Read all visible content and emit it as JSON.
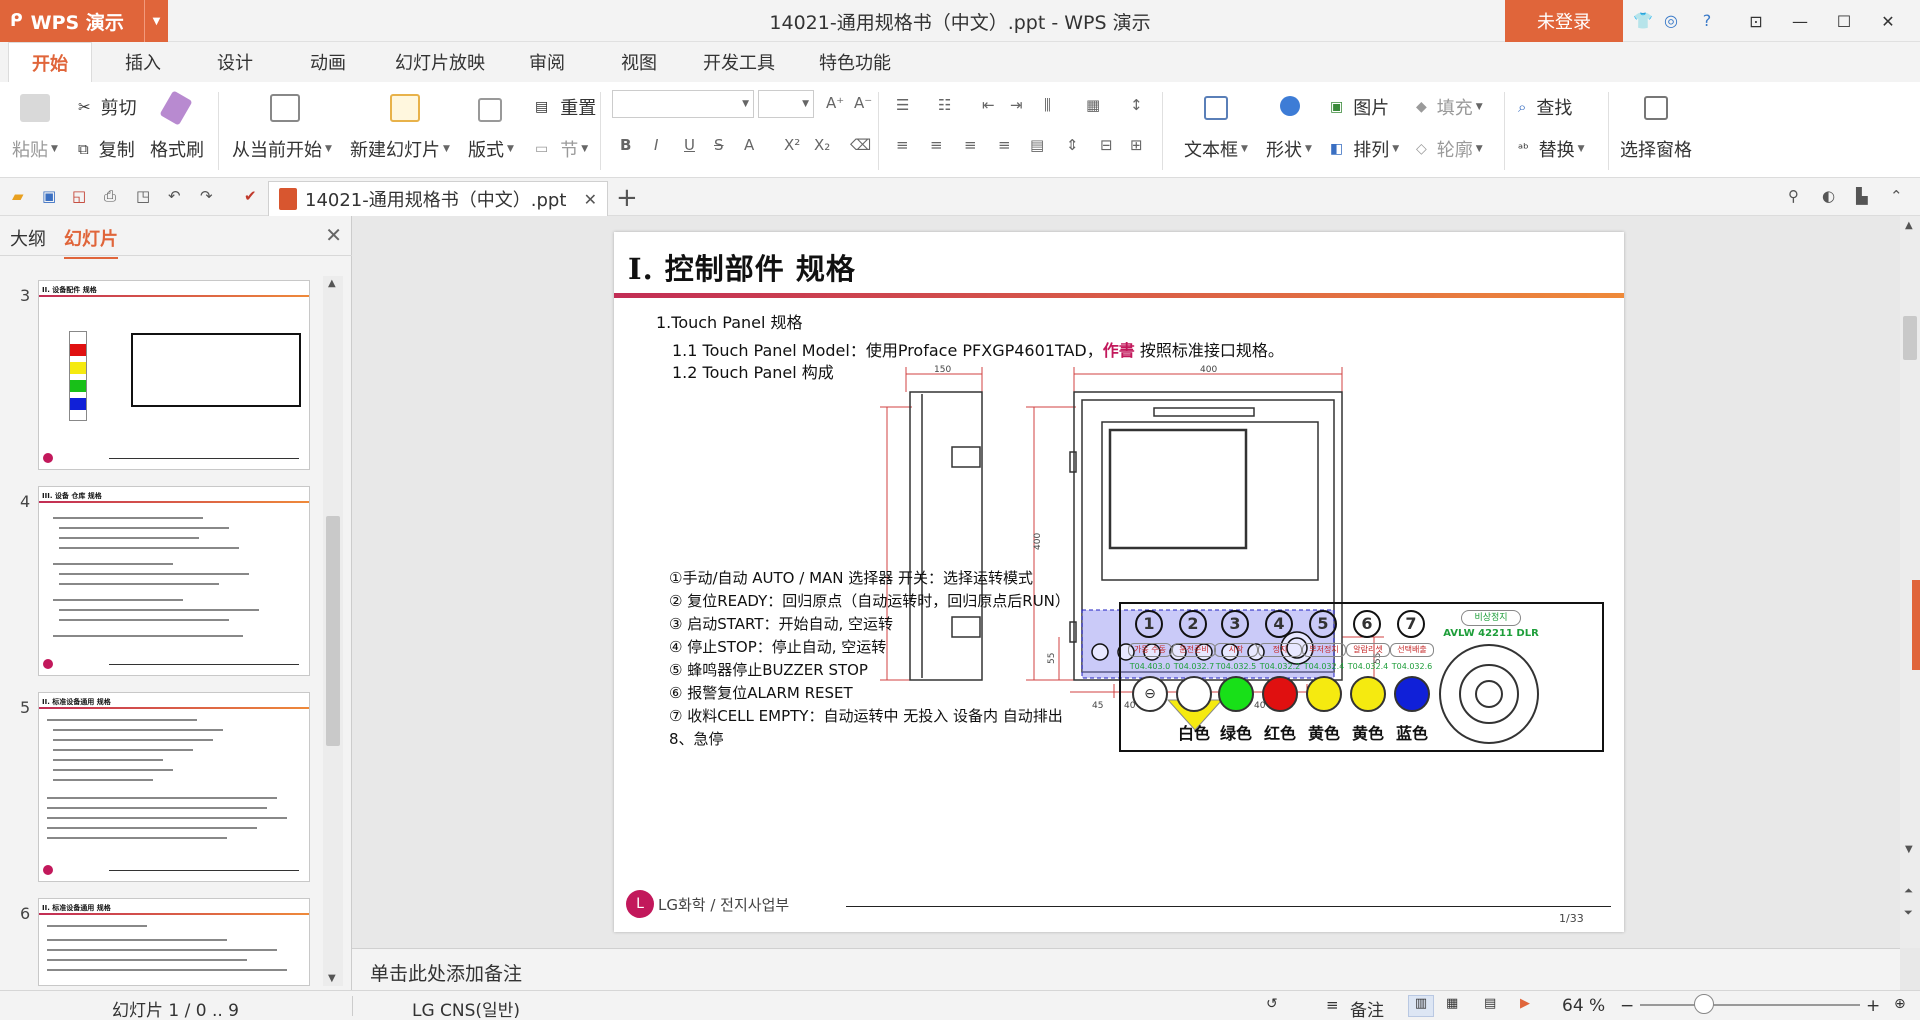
{
  "app": {
    "name": "WPS 演示",
    "login": "未登录"
  },
  "window": {
    "title": "14021-通用规格书（中文）.ppt - WPS 演示"
  },
  "menu_tabs": [
    "开始",
    "插入",
    "设计",
    "动画",
    "幻灯片放映",
    "审阅",
    "视图",
    "开发工具",
    "特色功能"
  ],
  "ribbon": {
    "paste": "粘贴",
    "cut": "剪切",
    "copy": "复制",
    "format_painter": "格式刷",
    "from_current": "从当前开始",
    "new_slide": "新建幻灯片",
    "layout": "版式",
    "section": "节",
    "reset": "重置",
    "textbox": "文本框",
    "shape": "形状",
    "picture": "图片",
    "arrange": "排列",
    "fill": "填充",
    "outline": "轮廓",
    "find": "查找",
    "replace": "替换",
    "select_pane": "选择窗格"
  },
  "doc_tab": {
    "label": "14021-通用规格书（中文）.ppt"
  },
  "left_panel": {
    "tab_outline": "大纲",
    "tab_slides": "幻灯片",
    "thumbnails": [
      {
        "num": "3",
        "title": "II. 设备配件 规格"
      },
      {
        "num": "4",
        "title": "III. 设备 仓库 规格"
      },
      {
        "num": "5",
        "title": "II. 标准设备通用 规格"
      },
      {
        "num": "6",
        "title": "II. 标准设备通用 规格"
      }
    ]
  },
  "slide": {
    "title": "I. 控制部件  规格",
    "heading": "1.Touch Panel 规格",
    "line1_pre": "1.1 Touch Panel Model：使用Proface PFXGP4601TAD，",
    "line1_hl": "作書",
    "line1_post": " 按照标准接口规格。",
    "line2": "1.2 Touch Panel 构成",
    "items": [
      "①手动/自动 AUTO / MAN 选择器 开关：选择运转模式",
      "② 复位READY：回归原点（自动运转时，回归原点后RUN）",
      "③ 启动START：开始自动, 空运转",
      "④ 停止STOP：停止自动, 空运转",
      "⑤ 蜂鸣器停止BUZZER STOP",
      "⑥ 报警复位ALARM RESET",
      "⑦ 收料CELL EMPTY：自动运转中 无投入 设备内 自动排出",
      "8、急停"
    ],
    "dims": {
      "d150": "150",
      "d400_top": "400",
      "d400_side": "400",
      "d45": "45",
      "d40a": "40",
      "d40b": "40",
      "d60": "60",
      "d55a": "55",
      "d55b": "55",
      "d55c": "55"
    },
    "buttons": [
      {
        "num": "1",
        "label": "가동 수동",
        "code": "T04.403.0",
        "color_name": "",
        "color": "#ffffff"
      },
      {
        "num": "2",
        "label": "운전준비",
        "code": "T04.032.7",
        "color_name": "白色",
        "color": "#ffffff"
      },
      {
        "num": "3",
        "label": "시작",
        "code": "T04.032.5",
        "color_name": "绿色",
        "color": "#18e018"
      },
      {
        "num": "4",
        "label": "정지",
        "code": "T04.032.2",
        "color_name": "红色",
        "color": "#e01010"
      },
      {
        "num": "5",
        "label": "부저정지",
        "code": "T04.032.4",
        "color_name": "黄色",
        "color": "#f5ea10"
      },
      {
        "num": "6",
        "label": "알람리셋",
        "code": "T04.032.4",
        "color_name": "黄色",
        "color": "#f5ea10"
      },
      {
        "num": "7",
        "label": "선택배출",
        "code": "T04.032.6",
        "color_name": "蓝色",
        "color": "#1020d8"
      }
    ],
    "estop_label": "비상정지",
    "estop_code": "AVLW 42211 DLR",
    "footer_company": "LG화학  /  전지사업부",
    "page": "1/33"
  },
  "notes_placeholder": "单击此处添加备注",
  "status": {
    "slide_info": "幻灯片 1 / 0 .. 9",
    "theme": "LG CNS(일반)",
    "notes_btn": "备注",
    "zoom": "64 %"
  },
  "colors": {
    "accent": "#e0653a",
    "slide_bar_start": "#c22d55",
    "slide_bar_end": "#ef8a3a"
  }
}
